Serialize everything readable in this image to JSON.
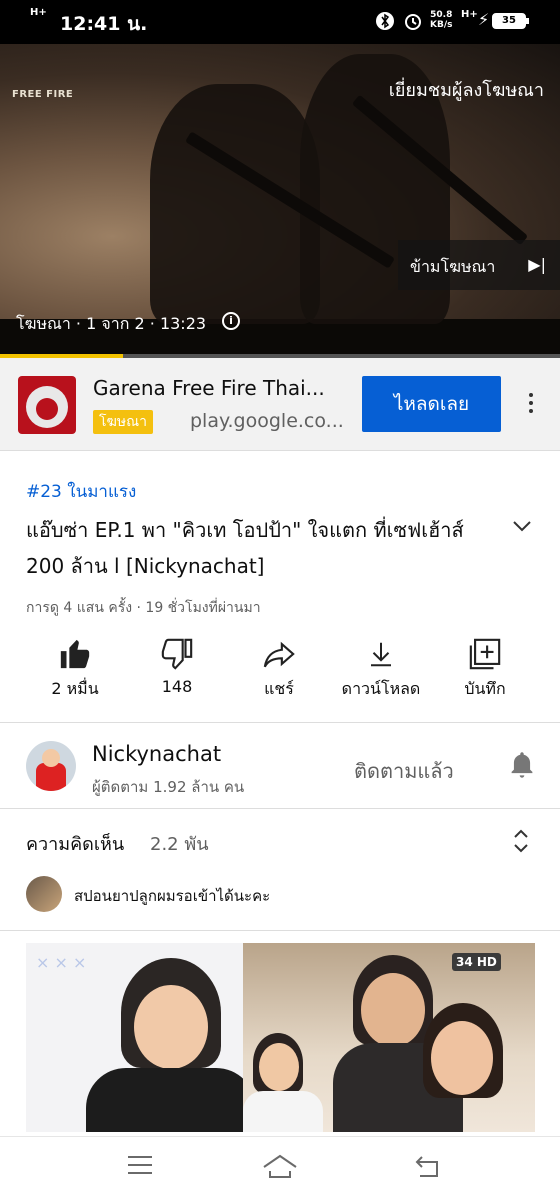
{
  "status_bar": {
    "network_left": "H+",
    "time": "12:41 น.",
    "speed_value": "50.8",
    "speed_unit": "KB/s",
    "network_right": "H+",
    "battery": "35"
  },
  "video": {
    "game_logo": "FREE FIRE",
    "visit_advertiser": "เยี่ยมชมผู้ลงโฆษณา",
    "skip_ad": "ข้ามโฆษณา",
    "ad_info": "โฆษณา · 1 จาก 2 · 13:23",
    "progress": 0.22
  },
  "ad": {
    "title": "Garena Free Fire Thai...",
    "badge": "โฆษณา",
    "url": "play.google.co...",
    "install": "ไหลดเลย"
  },
  "video_info": {
    "trending": "#23 ในมาแรง",
    "title": "แอ๊บซ่า EP.1 พา \"คิวเท โอปป้า\" ใจแตก ที่เซฟเฮ้าส์ 200 ล้าน l [Nickynachat]",
    "views": "การดู 4 แสน ครั้ง · 19 ชั่วโมงที่ผ่านมา"
  },
  "actions": {
    "like": "2 หมื่น",
    "dislike": "148",
    "share": "แชร์",
    "download": "ดาวน์โหลด",
    "save": "บันทึก"
  },
  "channel": {
    "name": "Nickynachat",
    "subscribers": "ผู้ติดตาม 1.92 ล้าน คน",
    "subscribed": "ติดตามแล้ว"
  },
  "comments": {
    "label": "ความคิดเห็น",
    "count": "2.2 พัน",
    "top_comment": "สปอนยาปลูกผมรอเข้าได้นะคะ"
  },
  "thumbnail": {
    "channel_logo": "34 HD"
  },
  "icons": {
    "like": "thumbs-up-icon",
    "dislike": "thumbs-down-icon",
    "share": "share-icon",
    "download": "download-icon",
    "save": "playlist-add-icon",
    "bell": "bell-icon"
  }
}
